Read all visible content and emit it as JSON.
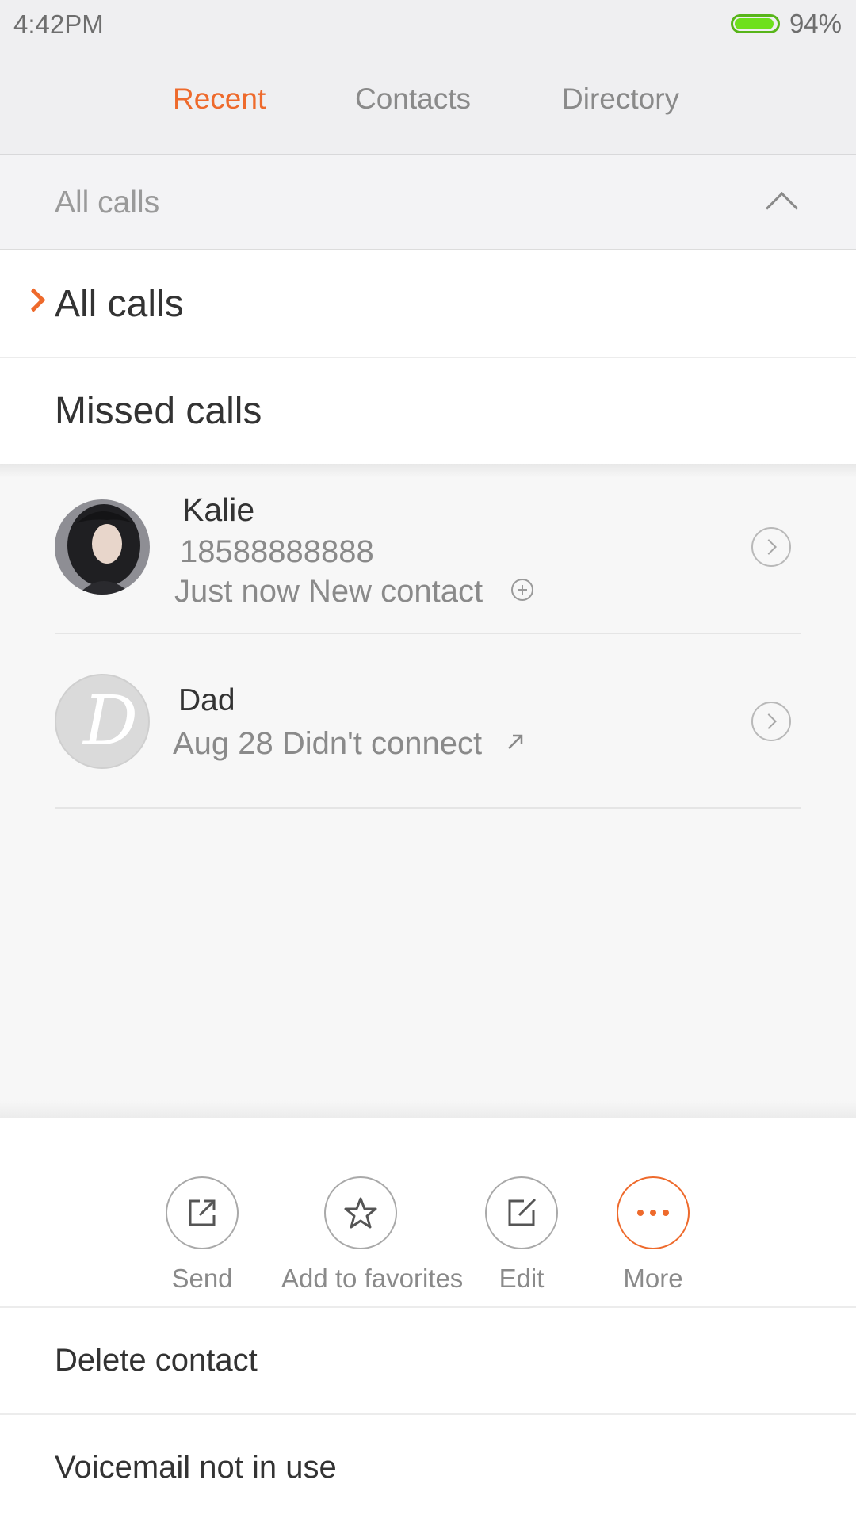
{
  "status_bar": {
    "time": "4:42PM",
    "battery": "94%",
    "battery_level": 0.94
  },
  "tabs": [
    {
      "label": "Recent",
      "active": true
    },
    {
      "label": "Contacts",
      "active": false
    },
    {
      "label": "Directory",
      "active": false
    }
  ],
  "filter": {
    "header_label": "All calls",
    "options": [
      {
        "label": "All calls",
        "selected": true
      },
      {
        "label": "Missed calls",
        "selected": false
      }
    ]
  },
  "calls": [
    {
      "name": "Kalie",
      "number": "18588888888",
      "detail": "Just now New contact",
      "detail_icon": "add-circle-icon"
    },
    {
      "name": "Dad",
      "detail": "Aug 28 Didn't connect",
      "detail_icon": "outgoing-arrow-icon",
      "avatar_letter": "D"
    }
  ],
  "sheet": {
    "actions": [
      {
        "label": "Send",
        "icon": "share-icon"
      },
      {
        "label": "Add to favorites",
        "icon": "star-icon"
      },
      {
        "label": "Edit",
        "icon": "edit-icon"
      },
      {
        "label": "More",
        "icon": "more-icon"
      }
    ],
    "items": [
      {
        "label": "Delete contact"
      },
      {
        "label": "Voicemail not in use"
      }
    ]
  },
  "colors": {
    "accent": "#ee6a2c",
    "battery": "#6ee01c"
  }
}
